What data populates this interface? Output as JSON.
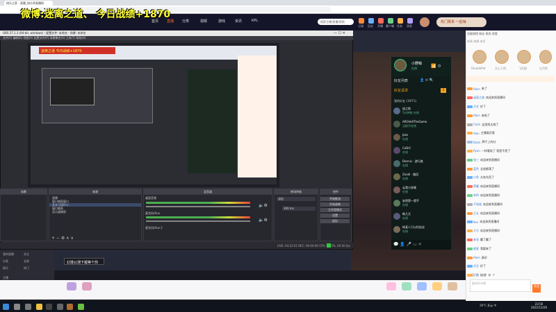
{
  "browser": {
    "tab_title": "快乐之家 - 直播_快乐秀直播网",
    "url": "www.huya.com/room"
  },
  "overlay": {
    "headline": "微博:迷离之道、 今日战绩+1870"
  },
  "site": {
    "nav": [
      "首页",
      "直播",
      "分类",
      "视频",
      "游戏",
      "资讯",
      "KPL"
    ],
    "search_placeholder": "搜索主播/直播/视频",
    "header_icons": [
      "订阅",
      "历史",
      "开播",
      "客户端",
      "任务",
      "消息"
    ],
    "promo": "热门赛事 一起嗨"
  },
  "obs": {
    "title": "OBS 27.1.3 (64-bit, windows) - 配置文件: 未命名 - 场景: 未命名",
    "menu": "文件(F)  编辑(E)  视图(V)  配置文件(P)  场景集合(S)  工具(T)  帮助(H)",
    "nested_overlay": "迷离之道 今日战绩+1870",
    "docks": {
      "scenes": "场景",
      "sources": "来源",
      "mixer": "混音器",
      "transitions": "转场特效",
      "controls": "控件"
    },
    "sources": [
      {
        "name": "直播"
      },
      {
        "name": "窗口捕获窗口"
      },
      {
        "name": "文本 (GDI+)",
        "selected": true
      },
      {
        "name": "窗口捕获"
      },
      {
        "name": "显示器捕获"
      }
    ],
    "mixer": [
      {
        "label": "桌面音频"
      },
      {
        "label": "麦克风/Aux"
      },
      {
        "label": "麦克风/Aux 2"
      }
    ],
    "transition": "淡出",
    "duration": "300 ms",
    "controls": [
      "开始推流",
      "开始录制",
      "工作室模式",
      "设置",
      "退出"
    ],
    "status": "LIVE: 04:22:01   REC: 00:00:00   CPU: 14.0%, 60.00 fps"
  },
  "left_panel": {
    "items": [
      "我的直播",
      "关注",
      "分类",
      "全部",
      "娱乐",
      "热门",
      "主播"
    ],
    "btn1": "客户端打开",
    "btn2": "管理中心"
  },
  "notification": "幻境公测下载等个你",
  "chat_overlay": {
    "streamer": "小野萌",
    "status": "在线",
    "tab": "好友列表",
    "subtab": "好友请求",
    "group": "我的好友 (19/71)",
    "friends": [
      {
        "name": "迷之助",
        "status": "5分钟前 在线"
      },
      {
        "name": "ARGHsIlTheGame",
        "status": "当前不在线"
      },
      {
        "name": "Jakz",
        "status": "在线"
      },
      {
        "name": "CoBrC",
        "status": "在线"
      },
      {
        "name": "Dennis · 游行路",
        "status": "在线"
      },
      {
        "name": "Zoodi · 路回",
        "status": "在线"
      },
      {
        "name": "云我小逆毒",
        "status": "在线"
      },
      {
        "name": "安然第一猎手",
        "status": "在线"
      },
      {
        "name": "韩几天",
        "status": "在线"
      },
      {
        "name": "帐某人只以托松丝",
        "status": "在线"
      }
    ]
  },
  "chat_panel": {
    "top_tabs": "贡献周榜  粉丝  贵宾  房管",
    "sub_tabs": "本场  本周  本月",
    "fans": [
      "DoublePot",
      "天上人间",
      "飞天鼠",
      "九月余"
    ],
    "messages": [
      {
        "user": "Aken",
        "text": "来了",
        "badge": "#ff9a3a"
      },
      {
        "user": "迷离之道",
        "text": "欢迎来到直播间",
        "badge": "#ff6a5a"
      },
      {
        "user": "天空",
        "text": "好了",
        "badge": "#6ab0ff"
      },
      {
        "user": "Aken",
        "text": "来啦了",
        "badge": "#ff9a3a"
      },
      {
        "user": "Clark",
        "text": "这游戏太难了",
        "badge": "#b0b0b0"
      },
      {
        "user": "Alan",
        "text": "主播真厉害",
        "badge": "#ffb04a"
      },
      {
        "user": "Stark",
        "text": "牌子上的分",
        "badge": "#a0c0e0"
      },
      {
        "user": "Ryan",
        "text": "一样看啥了 我是不是了",
        "badge": "#ffb04a"
      },
      {
        "user": "张三",
        "text": "欢迎来到直播间",
        "badge": "#6ad08a"
      },
      {
        "user": "蓝色",
        "text": "全部都满了",
        "badge": "#ff9a3a"
      },
      {
        "user": "小鱼",
        "text": "太有东西了",
        "badge": "#6ab0ff"
      },
      {
        "user": "荣耀",
        "text": "欢迎来到直播间",
        "badge": "#ff6a5a"
      },
      {
        "user": "李四",
        "text": "欢迎来到直播间",
        "badge": "#6ad08a"
      },
      {
        "user": "不知道",
        "text": "欢迎来到直播间",
        "badge": "#b0b0b0"
      },
      {
        "user": "王五",
        "text": "欢迎来到直播间",
        "badge": "#ff9a3a"
      },
      {
        "user": "Ken",
        "text": "欢迎来到直播间",
        "badge": "#6ab0ff"
      },
      {
        "user": "大力",
        "text": "欢迎来到直播间",
        "badge": "#ffb04a"
      },
      {
        "user": "老张",
        "text": "赢了赢了",
        "badge": "#ff6a5a"
      },
      {
        "user": "星星",
        "text": "我要来了",
        "badge": "#6ad08a"
      },
      {
        "user": "Aken",
        "text": "真好",
        "badge": "#ff9a3a"
      },
      {
        "user": "天空",
        "text": "好了",
        "badge": "#6ab0ff"
      },
      {
        "user": "小鱼",
        "text": "加油",
        "badge": "#ffb04a"
      }
    ],
    "input_placeholder": "说点什么吧",
    "send": "发送"
  },
  "taskbar": {
    "tray": "28°C 多云  中",
    "time": "23:50",
    "date": "2021/12/20"
  }
}
